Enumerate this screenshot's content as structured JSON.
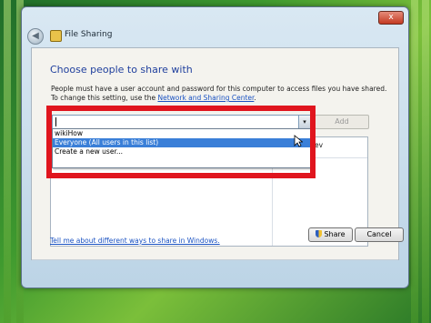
{
  "window": {
    "title": "File Sharing",
    "close_label": "x",
    "back_label": "◀"
  },
  "main": {
    "heading": "Choose people to share with",
    "description_part1": "People must have a user account and password for this computer to access files you have shared.  To change this setting, use the ",
    "description_link": "Network and Sharing Center",
    "description_part2": ".",
    "input_value": "",
    "add_label": "Add",
    "dropdown_arrow": "▾",
    "dropdown_items": [
      "wikiHow",
      "Everyone (All users in this list)",
      "Create a new user..."
    ],
    "permission_header_partial": "Lev",
    "help_link": "Tell me about different ways to share in Windows."
  },
  "footer": {
    "share_label": "Share",
    "cancel_label": "Cancel"
  },
  "colors": {
    "highlight": "#e0151e",
    "selection": "#3a7fd8",
    "link": "#1a52c2"
  }
}
